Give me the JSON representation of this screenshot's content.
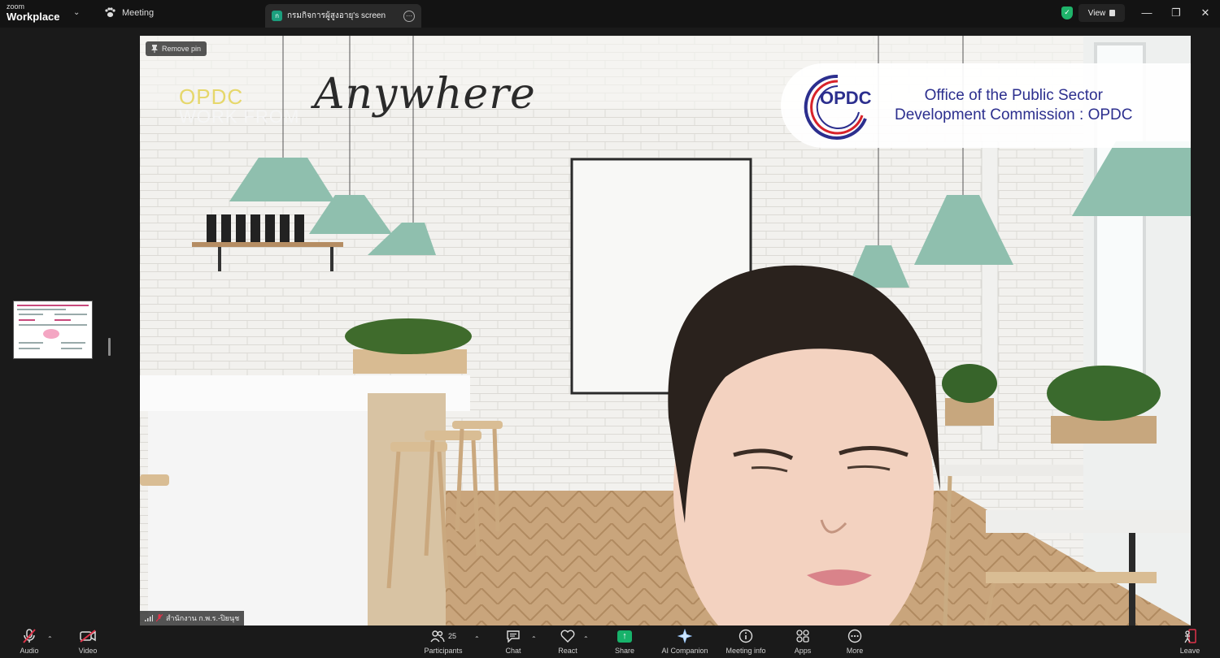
{
  "titlebar": {
    "brand_top": "zoom",
    "brand_bottom": "Workplace",
    "meeting_tab": "Meeting",
    "screen_tab_badge": "ก",
    "screen_tab": "กรมกิจการผู้สูงอายุ's screen",
    "view_label": "View"
  },
  "video": {
    "remove_pin": "Remove pin",
    "bg_line1": "OPDC",
    "bg_line2": "WORK FROM",
    "bg_script": "Anywhere",
    "logo_text": "OPDC",
    "org_line1": "Office of the Public Sector",
    "org_line2": "Development Commission : OPDC",
    "participant_label": "สำนักงาน ก.พ.ร.-ปิยนุช"
  },
  "controls": {
    "audio": "Audio",
    "video": "Video",
    "participants": "Participants",
    "participants_count": "25",
    "chat": "Chat",
    "react": "React",
    "share": "Share",
    "ai_companion": "AI Companion",
    "meeting_info": "Meeting info",
    "apps": "Apps",
    "more": "More",
    "leave": "Leave"
  },
  "colors": {
    "share_green": "#17b26a",
    "shield_green": "#1fb46a",
    "muted_red": "#e0334a",
    "opdc_navy": "#2c2f8e"
  }
}
